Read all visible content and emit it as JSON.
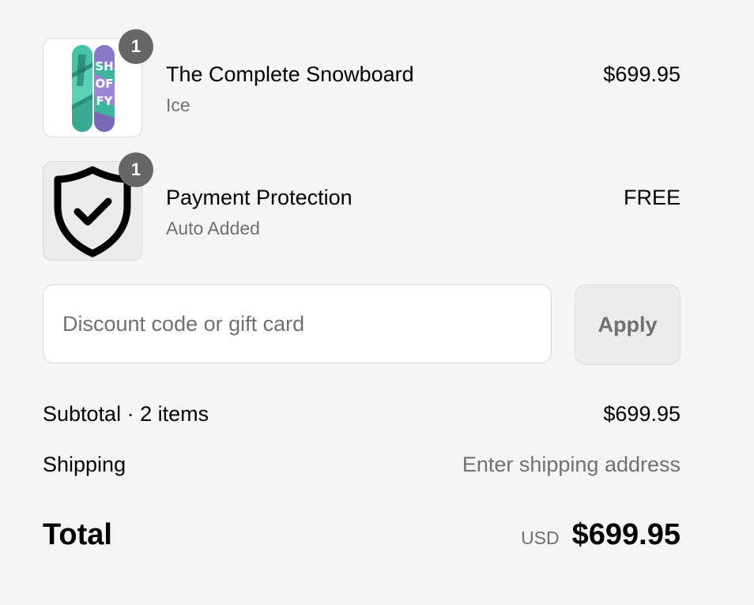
{
  "line_items": [
    {
      "quantity": "1",
      "title": "The Complete Snowboard",
      "variant": "Ice",
      "price": "$699.95",
      "thumbnail_icon": "snowboard-image"
    },
    {
      "quantity": "1",
      "title": "Payment Protection",
      "variant": "Auto Added",
      "price": "FREE",
      "thumbnail_icon": "shield-check-icon"
    }
  ],
  "discount": {
    "placeholder": "Discount code or gift card",
    "value": "",
    "apply_label": "Apply"
  },
  "totals": {
    "subtotal_label": "Subtotal · 2 items",
    "subtotal_value": "$699.95",
    "shipping_label": "Shipping",
    "shipping_value": "Enter shipping address",
    "total_label": "Total",
    "currency": "USD",
    "total_value": "$699.95"
  },
  "colors": {
    "background": "#f5f5f5",
    "badge": "#666666",
    "muted_text": "#707070",
    "board_teal": "#3fb5a0",
    "board_purple": "#8a78c8"
  }
}
